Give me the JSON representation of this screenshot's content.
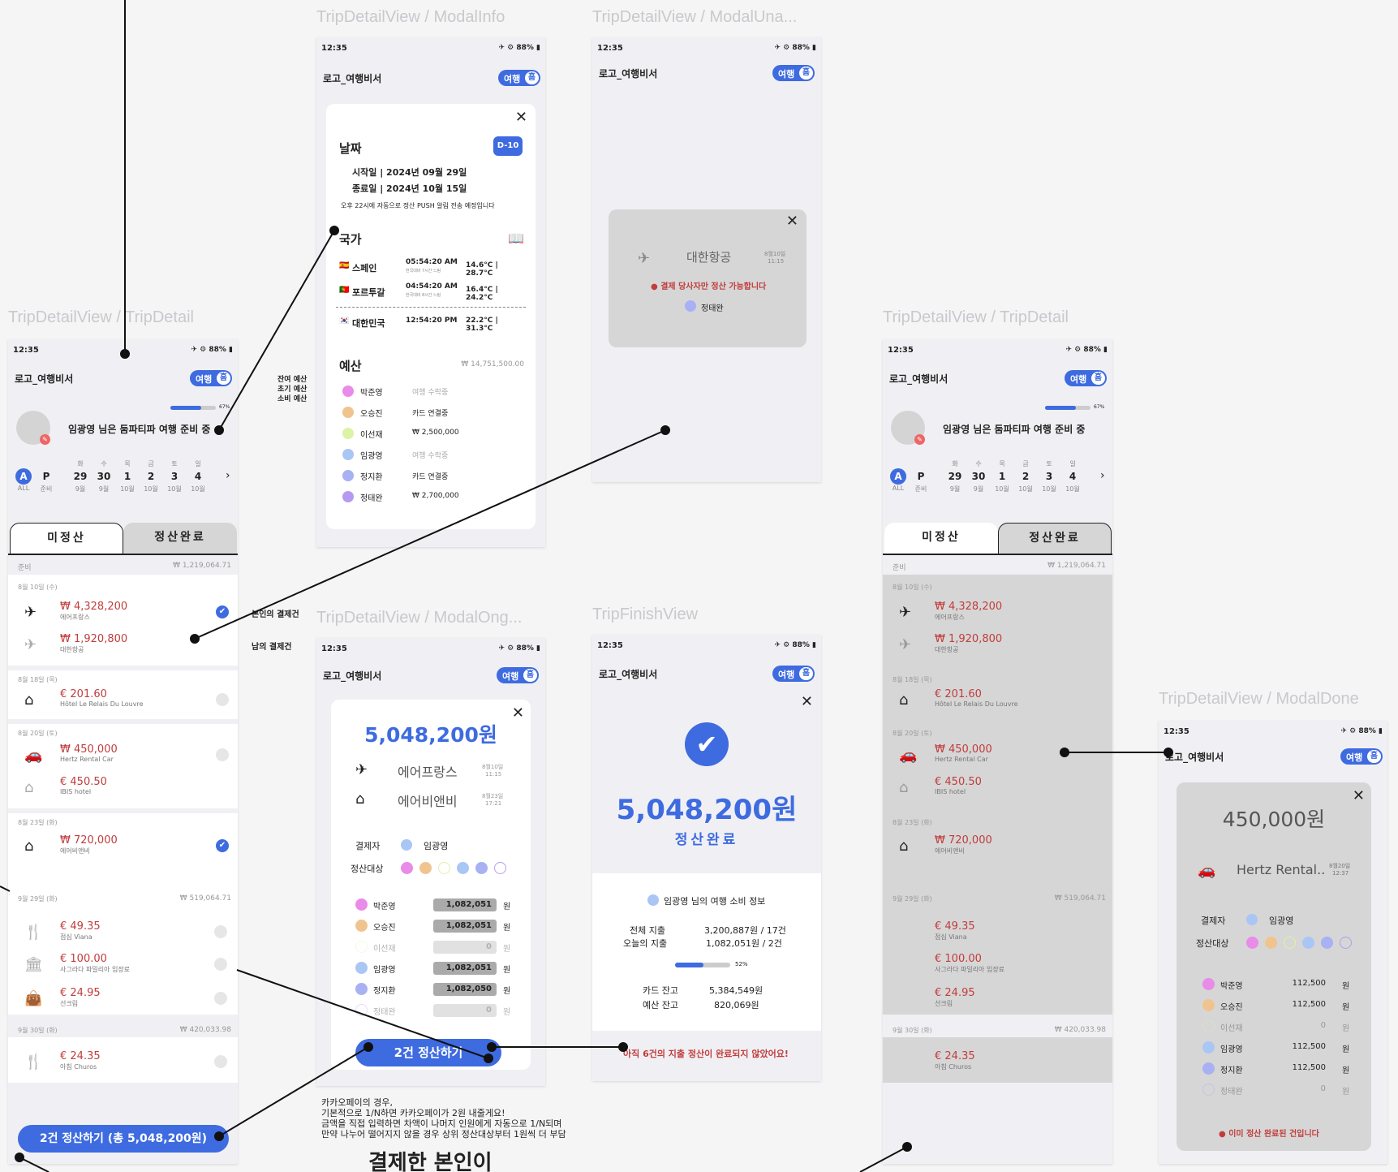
{
  "frames": {
    "trip1": "TripDetailView / TripDetail",
    "info": "TripDetailView / ModalInfo",
    "unavail": "TripDetailView / ModalUna...",
    "trip2": "TripDetailView / TripDetail",
    "ongoing": "TripDetailView / ModalOng...",
    "finish": "TripFinishView",
    "done": "TripDetailView / ModalDone"
  },
  "common": {
    "time": "12:35",
    "status": "✈ ⚙ 88% ▮",
    "logo": "로고_여행비서",
    "toggle_trip": "여행",
    "toggle_home": "홈"
  },
  "trip": {
    "progress_pct": "67%",
    "progress": 0.67,
    "message": "임광영 님은 둠파티파 여행 준비 중",
    "days": [
      {
        "top": "",
        "num": "A",
        "bot": "ALL"
      },
      {
        "top": "",
        "num": "P",
        "bot": "준비"
      },
      {
        "top": "화",
        "num": "29",
        "bot": "9월"
      },
      {
        "top": "수",
        "num": "30",
        "bot": "9월"
      },
      {
        "top": "목",
        "num": "1",
        "bot": "10월"
      },
      {
        "top": "금",
        "num": "2",
        "bot": "10월"
      },
      {
        "top": "토",
        "num": "3",
        "bot": "10월"
      },
      {
        "top": "일",
        "num": "4",
        "bot": "10월"
      }
    ],
    "chevron": "›",
    "tab_unsettled": "미정산",
    "tab_settled": "정산완료",
    "sec1_label": "준비",
    "sec1_total": "₩ 1,219,064.71",
    "d1": "8월 10일 (수)",
    "i1_amt": "₩ 4,328,200",
    "i1_sub": "에어프랑스",
    "i2_amt": "₩ 1,920,800",
    "i2_sub": "대한항공",
    "d2": "8월 18일 (목)",
    "i3_amt": "€ 201.60",
    "i3_sub": "Hôtel Le Relais Du Louvre",
    "d3": "8월 20일 (토)",
    "i4_amt": "₩ 450,000",
    "i4_sub": "Hertz Rental Car",
    "i5_amt": "€ 450.50",
    "i5_sub": "IBIS hotel",
    "d4": "8월 23일 (화)",
    "i6_amt": "₩ 720,000",
    "i6_sub": "에어비앤비",
    "sec2_label": "9월 29일 (화)",
    "sec2_total": "₩ 519,064.71",
    "i7_amt": "€ 49.35",
    "i7_sub": "점심 Viana",
    "i8_amt": "€ 100.00",
    "i8_sub": "사그라다 파밀리아 입장료",
    "i9_amt": "€ 24.95",
    "i9_sub": "선크림",
    "sec3_label": "9월 30일 (화)",
    "sec3_total": "₩ 420,033.98",
    "i10_amt": "€ 24.35",
    "i10_sub": "아침 Churos",
    "settle_btn": "2건 정산하기 (총 5,048,200원)"
  },
  "info": {
    "close": "✕",
    "date_title": "날짜",
    "dday": "D-10",
    "start": "시작일 | 2024년 09월 29일",
    "end": "종료일 | 2024년 10월 15일",
    "push_note": "오후 22시에 자동으로 정산 PUSH 알림 전송 예정입니다",
    "country_title": "국가",
    "book_icon": "📖",
    "countries": [
      {
        "flag": "🇪🇸",
        "name": "스페인",
        "time": "05:54:20 AM",
        "diff": "한국대비 7시간 느림",
        "temp": "14.6°C | 28.7°C"
      },
      {
        "flag": "🇵🇹",
        "name": "포르투갈",
        "time": "04:54:20 AM",
        "diff": "한국대비 8시간 느림",
        "temp": "16.4°C | 24.2°C"
      },
      {
        "flag": "🇰🇷",
        "name": "대한민국",
        "time": "12:54:20 PM",
        "diff": "",
        "temp": "22.2°C | 31.3°C"
      }
    ],
    "budget_title": "예산",
    "budget_total": "₩ 14,751,500.00",
    "members": [
      {
        "name": "박준영",
        "value": "여행 수락중",
        "color": "#e98be8"
      },
      {
        "name": "오승진",
        "value": "카드 연결중",
        "color": "#f0c48e"
      },
      {
        "name": "이선재",
        "value": "₩ 2,500,000",
        "color": "#dcf3a6"
      },
      {
        "name": "임광영",
        "value": "여행 수락중",
        "color": "#a9c6f5"
      },
      {
        "name": "정지환",
        "value": "카드 연결중",
        "color": "#a7b1f3"
      },
      {
        "name": "정태완",
        "value": "₩ 2,700,000",
        "color": "#b69af2"
      }
    ],
    "side_note1": "잔여 예산",
    "side_note2": "초기 예산",
    "side_note3": "소비 예산"
  },
  "unavail": {
    "close": "✕",
    "airline": "대한항공",
    "date": "8월10일",
    "time": "11:15",
    "warning": "● 결제 당사자만 정산 가능합니다",
    "payer": "정태완"
  },
  "ongoing": {
    "close": "✕",
    "amount": "5,048,200원",
    "e1": "에어프랑스",
    "e1_date": "8월10일",
    "e1_time": "11:15",
    "e2": "에어비앤비",
    "e2_date": "8월23일",
    "e2_time": "17:21",
    "payer_label": "결제자",
    "payer": "임광영",
    "target_label": "정산대상",
    "rows": [
      {
        "name": "박준영",
        "amount": "1,082,051",
        "unit": "원",
        "color": "#e98be8",
        "active": true
      },
      {
        "name": "오승진",
        "amount": "1,082,051",
        "unit": "원",
        "color": "#f0c48e",
        "active": true
      },
      {
        "name": "이선재",
        "amount": "0",
        "unit": "원",
        "color": "#dcf3a6",
        "active": false
      },
      {
        "name": "임광영",
        "amount": "1,082,051",
        "unit": "원",
        "color": "#a9c6f5",
        "active": true
      },
      {
        "name": "정지환",
        "amount": "1,082,050",
        "unit": "원",
        "color": "#a7b1f3",
        "active": true
      },
      {
        "name": "정태완",
        "amount": "0",
        "unit": "원",
        "color": "#b69af2",
        "active": false
      }
    ],
    "btn": "2건 정산하기"
  },
  "note": {
    "line1": "카카오페이의 경우,",
    "line2": "기본적으로 1/N하면 카카오페이가 2원 내줄게요!",
    "line3": "금액을 직접 입력하면 차액이 나머지 인원에게 자동으로 1/N되며",
    "line4": "만약 나누어 떨어지지 않을 경우 상위 정산대상부터 1원씩 더 부담",
    "big": "결제한 본인이",
    "self_paid": "본인의 결제건",
    "other_paid": "남의 결제건"
  },
  "finish": {
    "close": "✕",
    "amount": "5,048,200원",
    "done": "정산완료",
    "info_title": "임광영 님의 여행 소비 정보",
    "total_label": "전체 지출",
    "total_value": "3,200,887원 / 17건",
    "today_label": "오늘의 지출",
    "today_value": "1,082,051원 / 2건",
    "pct": "52%",
    "pct_value": 0.52,
    "card_label": "카드 잔고",
    "card_value": "5,384,549원",
    "budget_label": "예산 잔고",
    "budget_value": "820,069원",
    "warning": "아직 6건의 지출 정산이 완료되지 않았어요!"
  },
  "done": {
    "close": "✕",
    "amount": "450,000원",
    "item": "Hertz Rental..",
    "date": "8월20일",
    "time": "12:37",
    "payer_label": "결제자",
    "payer": "임광영",
    "target_label": "정산대상",
    "rows": [
      {
        "name": "박준영",
        "amount": "112,500",
        "unit": "원",
        "color": "#e98be8",
        "active": true
      },
      {
        "name": "오승진",
        "amount": "112,500",
        "unit": "원",
        "color": "#f0c48e",
        "active": true
      },
      {
        "name": "이선재",
        "amount": "0",
        "unit": "원",
        "color": "#dcf3a6",
        "active": false
      },
      {
        "name": "임광영",
        "amount": "112,500",
        "unit": "원",
        "color": "#a9c6f5",
        "active": true
      },
      {
        "name": "정지환",
        "amount": "112,500",
        "unit": "원",
        "color": "#a7b1f3",
        "active": true
      },
      {
        "name": "정태완",
        "amount": "0",
        "unit": "원",
        "color": "#b69af2",
        "active": false
      }
    ],
    "warning": "● 이미 정산 완료된 건입니다"
  },
  "colors": {
    "accent": "#3e6be0",
    "danger": "#c23c3c",
    "pink": "#e98be8",
    "orange": "#f0c48e",
    "lime": "#dcf3a6",
    "sky": "#a9c6f5",
    "periwinkle": "#a7b1f3",
    "purple": "#b69af2"
  }
}
